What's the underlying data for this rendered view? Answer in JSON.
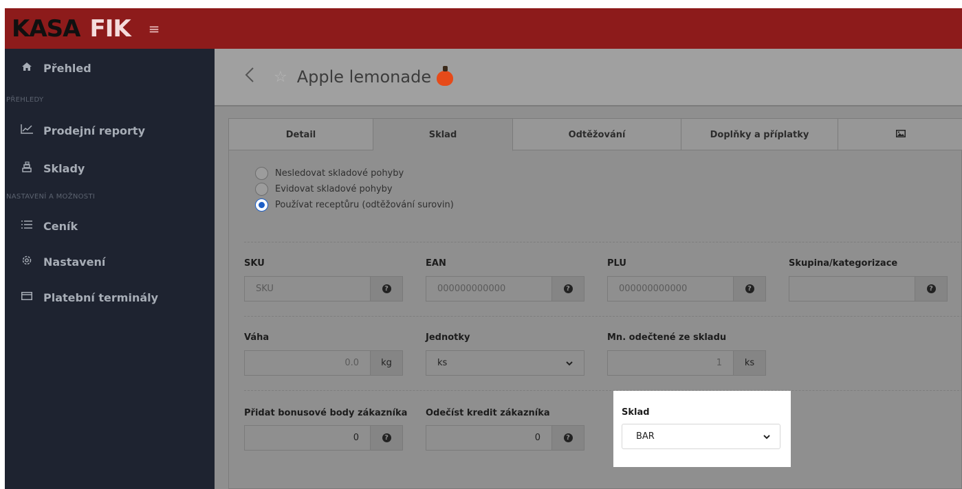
{
  "app": {
    "logo_part1": "KASA",
    "logo_part2": "FIK",
    "menu_icon": "≡"
  },
  "sidebar": {
    "items": [
      {
        "label": "Přehled",
        "icon": "home-icon"
      },
      {
        "section": "PŘEHLEDY"
      },
      {
        "label": "Prodejní reporty",
        "icon": "chart-line-icon"
      },
      {
        "label": "Sklady",
        "icon": "warehouse-icon"
      },
      {
        "section": "NASTAVENÍ A MOŽNOSTI"
      },
      {
        "label": "Ceník",
        "icon": "list-icon"
      },
      {
        "label": "Nastavení",
        "icon": "gear-icon"
      },
      {
        "label": "Platební terminály",
        "icon": "credit-card-icon"
      }
    ]
  },
  "header": {
    "title": "Apple lemonade"
  },
  "tabs": [
    {
      "label": "Detail",
      "active": false
    },
    {
      "label": "Sklad",
      "active": true
    },
    {
      "label": "Odtěžování",
      "active": false
    },
    {
      "label": "Doplňky a příplatky",
      "active": false
    },
    {
      "label": "",
      "icon": "image-icon",
      "active": false
    }
  ],
  "stock_mode": {
    "options": [
      {
        "label": "Nesledovat skladové pohyby",
        "checked": false
      },
      {
        "label": "Evidovat skladové pohyby",
        "checked": false
      },
      {
        "label": "Používat receptůru (odtěžování surovin)",
        "checked": true
      }
    ]
  },
  "fields": {
    "sku": {
      "label": "SKU",
      "placeholder": "SKU",
      "value": ""
    },
    "ean": {
      "label": "EAN",
      "placeholder": "000000000000",
      "value": ""
    },
    "plu": {
      "label": "PLU",
      "placeholder": "000000000000",
      "value": ""
    },
    "group": {
      "label": "Skupina/kategorizace",
      "value": ""
    },
    "weight": {
      "label": "Váha",
      "value": "0.0",
      "unit": "kg"
    },
    "units": {
      "label": "Jednotky",
      "selected": "ks"
    },
    "deducted": {
      "label": "Mn. odečtené ze skladu",
      "value": "1",
      "unit": "ks"
    },
    "bonus_points": {
      "label": "Přidat bonusové body zákazníka",
      "value": "0"
    },
    "credit": {
      "label": "Odečíst kredit zákazníka",
      "value": "0"
    },
    "warehouse": {
      "label": "Sklad",
      "selected": "BAR"
    }
  },
  "help_glyph": "?",
  "chevron_glyph": "⌄"
}
